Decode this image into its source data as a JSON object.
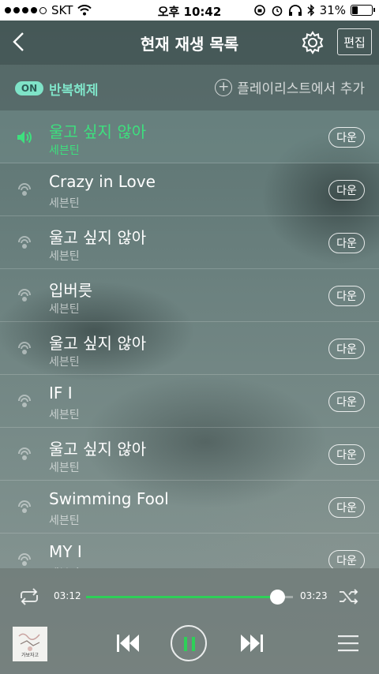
{
  "status_bar": {
    "carrier": "SKT",
    "time": "오후 10:42",
    "battery": "31%",
    "battery_level": 0.31
  },
  "header": {
    "title": "현재 재생 목록",
    "edit_label": "편집"
  },
  "repeat_bar": {
    "on_badge": "ON",
    "repeat_label": "반복해제",
    "add_playlist_label": "플레이리스트에서 추가"
  },
  "playlist": {
    "down_label": "다운",
    "items": [
      {
        "title": "울고 싶지 않아",
        "artist": "세븐틴",
        "playing": true
      },
      {
        "title": "Crazy in Love",
        "artist": "세븐틴",
        "playing": false
      },
      {
        "title": "울고 싶지 않아",
        "artist": "세븐틴",
        "playing": false
      },
      {
        "title": "입버릇",
        "artist": "세븐틴",
        "playing": false
      },
      {
        "title": "울고 싶지 않아",
        "artist": "세븐틴",
        "playing": false
      },
      {
        "title": "IF I",
        "artist": "세븐틴",
        "playing": false
      },
      {
        "title": "울고 싶지 않아",
        "artist": "세븐틴",
        "playing": false
      },
      {
        "title": "Swimming Fool",
        "artist": "세븐틴",
        "playing": false
      },
      {
        "title": "MY I",
        "artist": "세븐틴",
        "playing": false
      }
    ]
  },
  "player": {
    "current_time": "03:12",
    "total_time": "03:23",
    "progress": 0.925,
    "accent_color": "#2ed058",
    "album_art_text": "가보자고"
  },
  "colors": {
    "playing_title": "#3de07e",
    "on_badge_bg": "#7fe3c8"
  }
}
